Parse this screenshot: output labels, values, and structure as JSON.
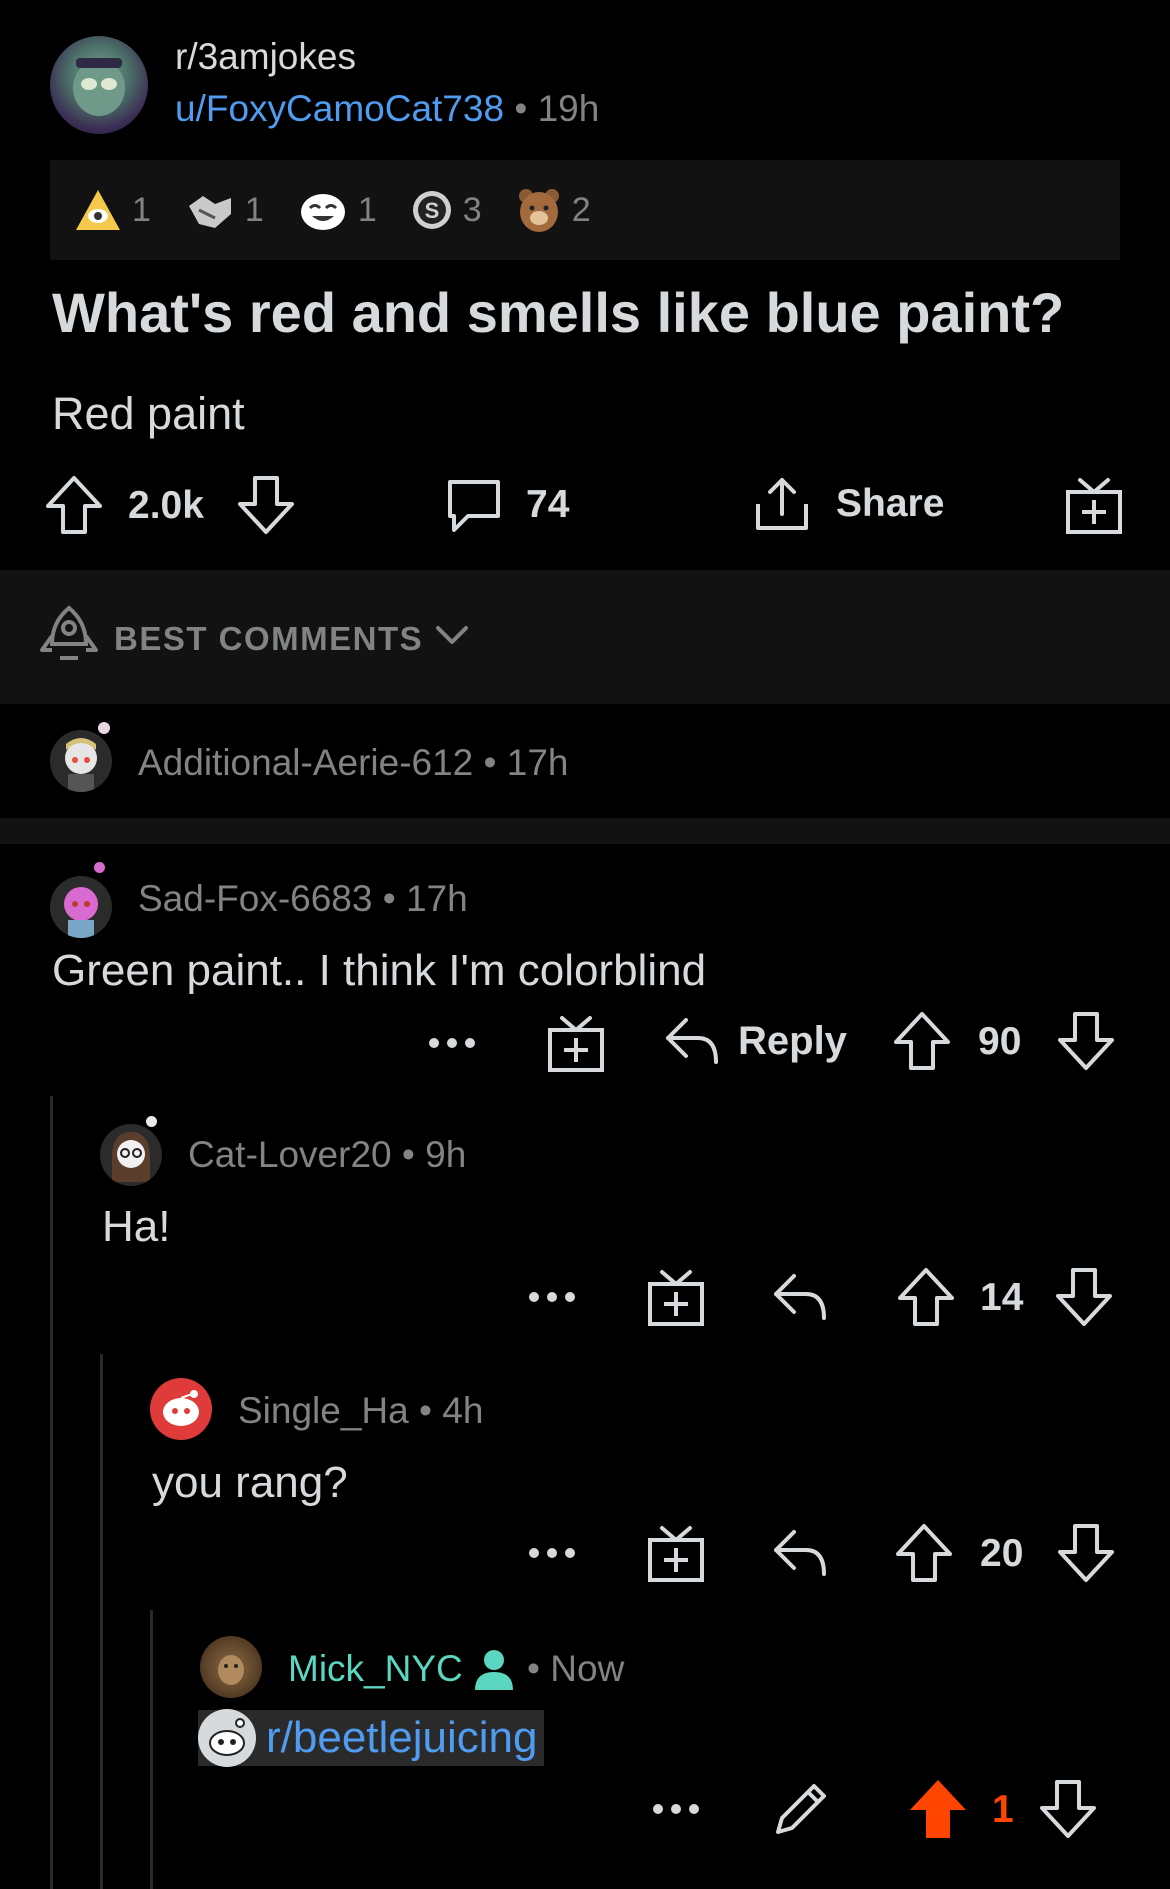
{
  "post": {
    "subreddit": "r/3amjokes",
    "author": "u/FoxyCamoCat738",
    "age": "19h",
    "awards": [
      {
        "icon": "eye-award-icon",
        "count": "1"
      },
      {
        "icon": "handshake-award-icon",
        "count": "1"
      },
      {
        "icon": "laughing-face-award-icon",
        "count": "1"
      },
      {
        "icon": "silver-coin-award-icon",
        "count": "3"
      },
      {
        "icon": "bear-award-icon",
        "count": "2"
      }
    ],
    "title": "What's red and smells like blue paint?",
    "body": "Red paint",
    "score": "2.0k",
    "comments": "74",
    "share_label": "Share"
  },
  "sort": {
    "label": "BEST COMMENTS"
  },
  "comments": [
    {
      "author": "Additional-Aerie-612",
      "age": "17h",
      "collapsed": true
    },
    {
      "author": "Sad-Fox-6683",
      "age": "17h",
      "body": "Green paint.. I think I'm colorblind",
      "reply_label": "Reply",
      "score": "90"
    },
    {
      "author": "Cat-Lover20",
      "age": "9h",
      "body": "Ha!",
      "score": "14"
    },
    {
      "author": "Single_Ha",
      "age": "4h",
      "body": "you rang?",
      "score": "20"
    },
    {
      "author": "Mick_NYC",
      "age": "Now",
      "body_link": "r/beetlejuicing",
      "score": "1"
    }
  ],
  "colors": {
    "upvote_active": "#ff4500",
    "link": "#4f9cf0",
    "op_teal": "#5bd6c0"
  }
}
